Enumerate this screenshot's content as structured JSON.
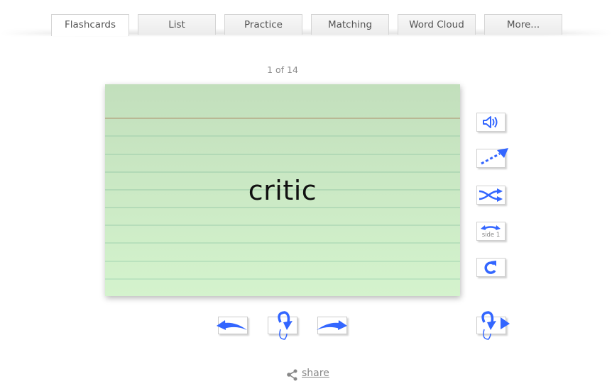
{
  "tabs": [
    {
      "label": "Flashcards",
      "active": true
    },
    {
      "label": "List",
      "active": false
    },
    {
      "label": "Practice",
      "active": false
    },
    {
      "label": "Matching",
      "active": false
    },
    {
      "label": "Word Cloud",
      "active": false
    },
    {
      "label": "More...",
      "active": false
    }
  ],
  "counter": {
    "current": 1,
    "total": 14,
    "text": "1 of 14"
  },
  "card": {
    "word": "critic",
    "side": 1
  },
  "side_controls": [
    {
      "name": "speak",
      "icon": "speaker-icon"
    },
    {
      "name": "auto-play",
      "icon": "dotted-arrow-icon"
    },
    {
      "name": "shuffle",
      "icon": "shuffle-icon"
    },
    {
      "name": "switch-side",
      "icon": "double-arrow-icon",
      "label": "side 1"
    },
    {
      "name": "restart",
      "icon": "refresh-icon"
    }
  ],
  "nav_controls": [
    {
      "name": "previous",
      "icon": "arrow-left-icon"
    },
    {
      "name": "flip",
      "icon": "flip-icon"
    },
    {
      "name": "next",
      "icon": "arrow-right-icon"
    },
    {
      "name": "flip-and-next",
      "icon": "flip-next-icon"
    }
  ],
  "share": {
    "label": "share",
    "icon": "share-icon"
  },
  "colors": {
    "accent": "#3366ff",
    "card_top": "#c2dfbc",
    "card_bottom": "#d4f3cd",
    "margin_line": "#b9b894",
    "rule_line": "#b2d9b6"
  }
}
